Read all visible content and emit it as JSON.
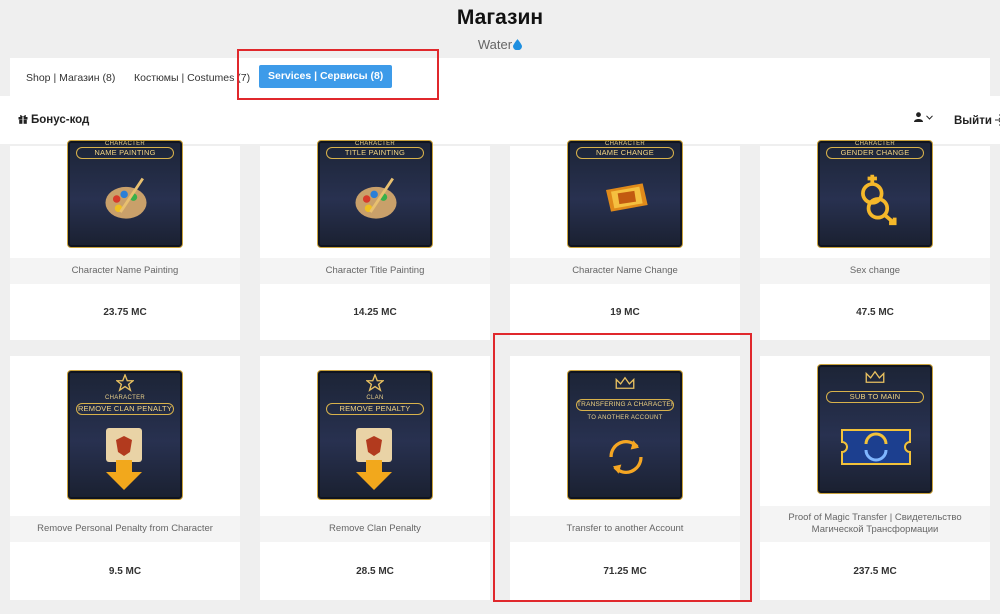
{
  "page": {
    "title": "Магазин",
    "server": "Water"
  },
  "tabs": [
    {
      "label": "Shop | Магазин (8)"
    },
    {
      "label": "Костюмы | Costumes (7)"
    },
    {
      "label": "Services | Сервисы (8)",
      "active": true
    }
  ],
  "toolbar": {
    "bonus_label": "Бонус-код",
    "logout_label": "Выйти"
  },
  "items": [
    {
      "name": "Character Name Painting",
      "price": "23.75 MC",
      "art_top": "CHARACTER",
      "art_banner": "NAME PAINTING",
      "icon": "palette-icon"
    },
    {
      "name": "Character Title Painting",
      "price": "14.25 MC",
      "art_top": "CHARACTER",
      "art_banner": "TITLE PAINTING",
      "icon": "palette-icon"
    },
    {
      "name": "Character Name Change",
      "price": "19 MC",
      "art_top": "CHARACTER",
      "art_banner": "NAME CHANGE",
      "icon": "scroll-ribbon-icon"
    },
    {
      "name": "Sex change",
      "price": "47.5 MC",
      "art_top": "CHARACTER",
      "art_banner": "GENDER CHANGE",
      "icon": "gender-icon"
    },
    {
      "name": "Remove Personal Penalty from Character",
      "price": "9.5 MC",
      "art_top": "CHARACTER",
      "art_banner": "REMOVE CLAN PENALTY",
      "icon": "scroll-arrow-icon"
    },
    {
      "name": "Remove Clan Penalty",
      "price": "28.5 MC",
      "art_top": "CLAN",
      "art_banner": "REMOVE PENALTY",
      "icon": "scroll-arrow-icon"
    },
    {
      "name": "Transfer to another Account",
      "price": "71.25 MC",
      "art_top": "",
      "art_banner": "TRANSFERING A CHARACTER",
      "art_sub": "TO ANOTHER ACCOUNT",
      "icon": "transfer-cycle-icon"
    },
    {
      "name": "Proof of Magic Transfer | Свидетельство Магической Трансформации",
      "price": "237.5 MC",
      "art_top": "",
      "art_banner": "SUB TO MAIN",
      "icon": "ticket-icon"
    }
  ],
  "colors": {
    "accent": "#3d9be9",
    "highlight": "#e0282c",
    "gold": "#c9a23c"
  }
}
